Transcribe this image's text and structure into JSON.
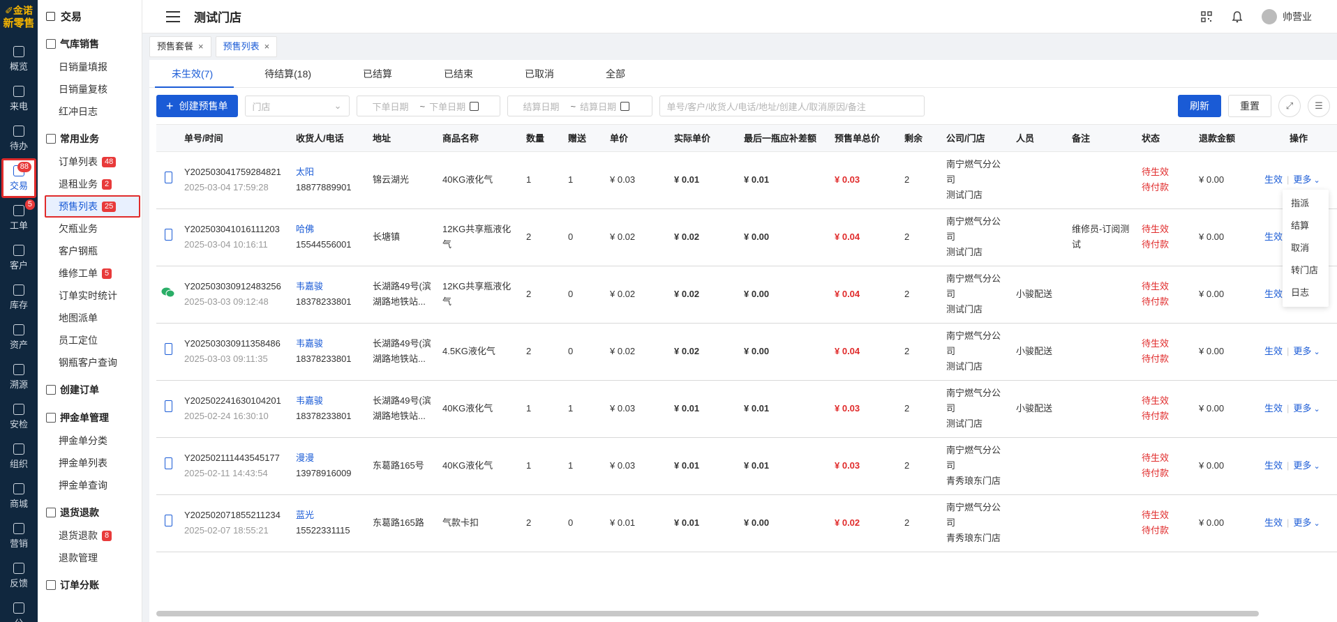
{
  "rail": {
    "logo_top": "✐金诺",
    "logo_bottom": "新零售",
    "items": [
      {
        "label": "概览",
        "icon": "chart-icon"
      },
      {
        "label": "来电",
        "icon": "phone-icon"
      },
      {
        "label": "待办",
        "icon": "bookmark-icon"
      },
      {
        "label": "交易",
        "icon": "bag-icon",
        "badge": "88",
        "active": true
      },
      {
        "label": "工单",
        "icon": "doc-icon",
        "badge": "5"
      },
      {
        "label": "客户",
        "icon": "idcard-icon"
      },
      {
        "label": "库存",
        "icon": "list-icon"
      },
      {
        "label": "资产",
        "icon": "bulb-icon"
      },
      {
        "label": "溯源",
        "icon": "compass-icon"
      },
      {
        "label": "安检",
        "icon": "shield-icon"
      },
      {
        "label": "组织",
        "icon": "org-icon"
      },
      {
        "label": "商城",
        "icon": "store-icon"
      },
      {
        "label": "营销",
        "icon": "trophy-icon"
      },
      {
        "label": "反馈",
        "icon": "chat-icon"
      },
      {
        "label": "公",
        "icon": "speaker-icon"
      }
    ]
  },
  "side": {
    "head": "交易",
    "groups": [
      {
        "title": "气库销售",
        "items": [
          {
            "label": "日销量填报"
          },
          {
            "label": "日销量复核"
          },
          {
            "label": "红冲日志"
          }
        ]
      },
      {
        "title": "常用业务",
        "items": [
          {
            "label": "订单列表",
            "badge": "48"
          },
          {
            "label": "退租业务",
            "badge": "2"
          },
          {
            "label": "预售列表",
            "badge": "25",
            "active": true
          },
          {
            "label": "欠瓶业务"
          },
          {
            "label": "客户钢瓶"
          },
          {
            "label": "维修工单",
            "badge": "5"
          },
          {
            "label": "订单实时统计"
          },
          {
            "label": "地图派单"
          },
          {
            "label": "员工定位"
          },
          {
            "label": "钢瓶客户查询"
          }
        ]
      },
      {
        "title": "创建订单",
        "items": []
      },
      {
        "title": "押金单管理",
        "items": [
          {
            "label": "押金单分类"
          },
          {
            "label": "押金单列表"
          },
          {
            "label": "押金单查询"
          }
        ]
      },
      {
        "title": "退货退款",
        "items": [
          {
            "label": "退货退款",
            "badge": "8"
          },
          {
            "label": "退款管理"
          }
        ]
      },
      {
        "title": "订单分账",
        "items": []
      }
    ]
  },
  "topbar": {
    "title": "测试门店",
    "username": "帅营业"
  },
  "pagetabs": [
    {
      "label": "预售套餐",
      "active": false
    },
    {
      "label": "预售列表",
      "active": true
    }
  ],
  "status_tabs": [
    {
      "label": "未生效(7)",
      "active": true
    },
    {
      "label": "待结算(18)"
    },
    {
      "label": "已结算"
    },
    {
      "label": "已结束"
    },
    {
      "label": "已取消"
    },
    {
      "label": "全部"
    }
  ],
  "toolbar": {
    "create_label": "创建预售单",
    "store_placeholder": "门店",
    "order_date_start": "下单日期",
    "order_date_end": "下单日期",
    "settle_date_start": "结算日期",
    "settle_date_end": "结算日期",
    "range_sep": "~",
    "search_placeholder": "单号/客户/收货人/电话/地址/创建人/取消原因/备注",
    "refresh_label": "刷新",
    "reset_label": "重置"
  },
  "table": {
    "columns": [
      "单号/时间",
      "收货人/电话",
      "地址",
      "商品名称",
      "数量",
      "赠送",
      "单价",
      "实际单价",
      "最后一瓶应补差额",
      "预售单总价",
      "剩余",
      "公司/门店",
      "人员",
      "备注",
      "状态",
      "退款金额",
      "操作"
    ],
    "rows": [
      {
        "channel": "phone",
        "no": "Y202503041759284821",
        "time": "2025-03-04 17:59:28",
        "name": "太阳",
        "phone": "18877889901",
        "addr": "锦云湖光",
        "product": "40KG液化气",
        "qty": "1",
        "gift": "1",
        "price": "¥ 0.03",
        "actual": "¥ 0.01",
        "diff": "¥ 0.01",
        "total": "¥ 0.03",
        "remain": "2",
        "company": "南宁燃气分公司",
        "store": "测试门店",
        "staff": "",
        "note": "",
        "status1": "待生效",
        "status2": "待付款",
        "refund": "¥ 0.00",
        "op1": "生效",
        "op2": "更多"
      },
      {
        "channel": "phone",
        "no": "Y202503041016111203",
        "time": "2025-03-04 10:16:11",
        "name": "哈佛",
        "phone": "15544556001",
        "addr": "长塘镇",
        "product": "12KG共享瓶液化气",
        "qty": "2",
        "gift": "0",
        "price": "¥ 0.02",
        "actual": "¥ 0.02",
        "diff": "¥ 0.00",
        "total": "¥ 0.04",
        "remain": "2",
        "company": "南宁燃气分公司",
        "store": "测试门店",
        "staff": "",
        "note": "维修员-订阅测试",
        "status1": "待生效",
        "status2": "待付款",
        "refund": "¥ 0.00",
        "op1": "生效",
        "op2": ""
      },
      {
        "channel": "wechat",
        "no": "Y202503030912483256",
        "time": "2025-03-03 09:12:48",
        "name": "韦嘉骏",
        "phone": "18378233801",
        "addr": "长湖路49号(滨湖路地铁站...",
        "product": "12KG共享瓶液化气",
        "qty": "2",
        "gift": "0",
        "price": "¥ 0.02",
        "actual": "¥ 0.02",
        "diff": "¥ 0.00",
        "total": "¥ 0.04",
        "remain": "2",
        "company": "南宁燃气分公司",
        "store": "测试门店",
        "staff": "小骏配送",
        "note": "",
        "status1": "待生效",
        "status2": "待付款",
        "refund": "¥ 0.00",
        "op1": "生效",
        "op2": ""
      },
      {
        "channel": "phone",
        "no": "Y202503030911358486",
        "time": "2025-03-03 09:11:35",
        "name": "韦嘉骏",
        "phone": "18378233801",
        "addr": "长湖路49号(滨湖路地铁站...",
        "product": "4.5KG液化气",
        "qty": "2",
        "gift": "0",
        "price": "¥ 0.02",
        "actual": "¥ 0.02",
        "diff": "¥ 0.00",
        "total": "¥ 0.04",
        "remain": "2",
        "company": "南宁燃气分公司",
        "store": "测试门店",
        "staff": "小骏配送",
        "note": "",
        "status1": "待生效",
        "status2": "待付款",
        "refund": "¥ 0.00",
        "op1": "生效",
        "op2": "更多"
      },
      {
        "channel": "phone",
        "no": "Y202502241630104201",
        "time": "2025-02-24 16:30:10",
        "name": "韦嘉骏",
        "phone": "18378233801",
        "addr": "长湖路49号(滨湖路地铁站...",
        "product": "40KG液化气",
        "qty": "1",
        "gift": "1",
        "price": "¥ 0.03",
        "actual": "¥ 0.01",
        "diff": "¥ 0.01",
        "total": "¥ 0.03",
        "remain": "2",
        "company": "南宁燃气分公司",
        "store": "测试门店",
        "staff": "小骏配送",
        "note": "",
        "status1": "待生效",
        "status2": "待付款",
        "refund": "¥ 0.00",
        "op1": "生效",
        "op2": "更多"
      },
      {
        "channel": "phone",
        "no": "Y202502111443545177",
        "time": "2025-02-11 14:43:54",
        "name": "漫漫",
        "phone": "13978916009",
        "addr": "东葛路165号",
        "product": "40KG液化气",
        "qty": "1",
        "gift": "1",
        "price": "¥ 0.03",
        "actual": "¥ 0.01",
        "diff": "¥ 0.01",
        "total": "¥ 0.03",
        "remain": "2",
        "company": "南宁燃气分公司",
        "store": "青秀琅东门店",
        "staff": "",
        "note": "",
        "status1": "待生效",
        "status2": "待付款",
        "refund": "¥ 0.00",
        "op1": "生效",
        "op2": "更多"
      },
      {
        "channel": "phone",
        "no": "Y202502071855211234",
        "time": "2025-02-07 18:55:21",
        "name": "蓝光",
        "phone": "15522331115",
        "addr": "东葛路165路",
        "product": "气款卡扣",
        "qty": "2",
        "gift": "0",
        "price": "¥ 0.01",
        "actual": "¥ 0.01",
        "diff": "¥ 0.00",
        "total": "¥ 0.02",
        "remain": "2",
        "company": "南宁燃气分公司",
        "store": "青秀琅东门店",
        "staff": "",
        "note": "",
        "status1": "待生效",
        "status2": "待付款",
        "refund": "¥ 0.00",
        "op1": "生效",
        "op2": "更多"
      }
    ]
  },
  "dropdown": [
    "指派",
    "结算",
    "取消",
    "转门店",
    "日志"
  ],
  "colors": {
    "primary": "#1a5bd6",
    "danger": "#e02b2b",
    "rail": "#10273e"
  }
}
